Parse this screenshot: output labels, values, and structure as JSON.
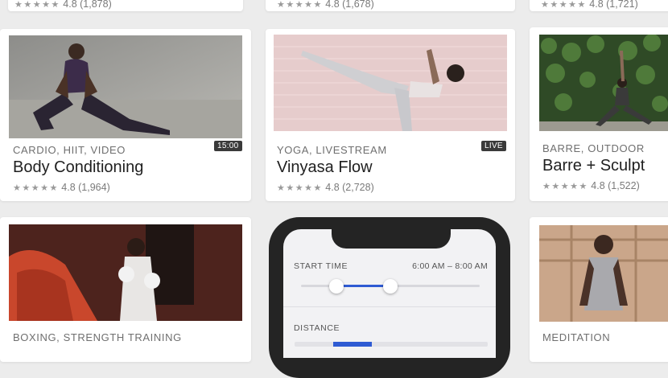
{
  "top_row": {
    "items": [
      {
        "rating": "4.8 (1,878)"
      },
      {
        "rating": "4.8 (1,678)"
      },
      {
        "rating": "4.8 (1,721)"
      }
    ]
  },
  "cards": [
    {
      "category": "CARDIO, HIIT, VIDEO",
      "title": "Body Conditioning",
      "rating": "4.8 (1,964)",
      "badge": "15:00"
    },
    {
      "category": "YOGA, LIVESTREAM",
      "title": "Vinyasa Flow",
      "rating": "4.8 (2,728)",
      "badge": "LIVE"
    },
    {
      "category": "BARRE, OUTDOOR",
      "title": "Barre + Sculpt",
      "rating": "4.8 (1,522)"
    },
    {
      "category": "BOXING, STRENGTH TRAINING"
    },
    {
      "category": "MEDITATION"
    }
  ],
  "stars": "★★★★★",
  "phone": {
    "start_time_label": "START TIME",
    "start_time_value": "6:00 AM – 8:00 AM",
    "start_time_range": [
      0.2,
      0.5
    ],
    "distance_label": "DISTANCE"
  },
  "colors": {
    "accent": "#2f5bd3",
    "badge": "#3a3a3a"
  }
}
